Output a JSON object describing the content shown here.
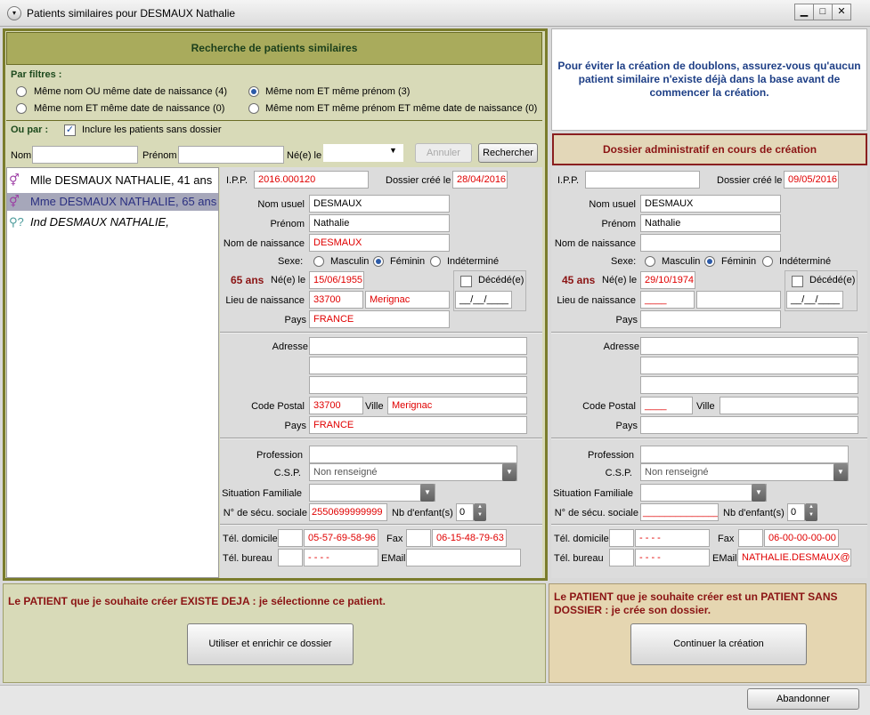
{
  "window": {
    "title": "Patients similaires pour DESMAUX Nathalie",
    "menu_icon": "▾",
    "minimize": "▁",
    "maximize": "□",
    "close": "✕"
  },
  "search": {
    "header": "Recherche de patients similaires",
    "filters_label": "Par filtres :",
    "filters": [
      {
        "label": "Même nom OU même date de naissance (4)",
        "selected": false
      },
      {
        "label": "Même nom ET même prénom (3)",
        "selected": true
      },
      {
        "label": "Même nom ET même date de naissance (0)",
        "selected": false
      },
      {
        "label": "Même nom ET même prénom ET même date de naissance (0)",
        "selected": false
      }
    ],
    "ou_par_label": "Ou par :",
    "include_no_file_label": "Inclure les patients sans dossier",
    "include_no_file_checked": "✓",
    "nom_label": "Nom",
    "prenom_label": "Prénom",
    "ne_le_label": "Né(e) le",
    "annuler_button": "Annuler",
    "rechercher_button": "Rechercher"
  },
  "results": [
    {
      "label": "Mlle DESMAUX NATHALIE, 41 ans",
      "icon": "female-icon",
      "selected": false
    },
    {
      "label": "Mme DESMAUX NATHALIE, 65 ans",
      "icon": "female-icon",
      "selected": true
    },
    {
      "label": "Ind DESMAUX NATHALIE,",
      "icon": "unknown-gender-icon",
      "selected": false
    }
  ],
  "labels": {
    "ipp": "I.P.P.",
    "dossier_cree": "Dossier créé le",
    "nom_usuel": "Nom usuel",
    "prenom": "Prénom",
    "nom_naissance": "Nom de naissance",
    "sexe": "Sexe:",
    "masculin": "Masculin",
    "feminin": "Féminin",
    "indetermine": "Indéterminé",
    "ne_le": "Né(e) le",
    "decede": "Décédé(e)",
    "lieu_naissance": "Lieu de naissance",
    "pays": "Pays",
    "adresse": "Adresse",
    "code_postal": "Code Postal",
    "ville": "Ville",
    "profession": "Profession",
    "csp": "C.S.P.",
    "situation_familiale": "Situation Familiale",
    "secu": "N° de sécu. sociale",
    "nb_enfants": "Nb d'enfant(s)",
    "tel_domicile": "Tél. domicile",
    "fax": "Fax",
    "tel_bureau": "Tél. bureau",
    "email": "EMail"
  },
  "existing": {
    "ipp": "2016.000120",
    "dossier_cree": "28/04/2016",
    "nom_usuel": "DESMAUX",
    "prenom": "Nathalie",
    "nom_naissance": "DESMAUX",
    "age": "65 ans",
    "naissance": "15/06/1955",
    "deces": "__/__/____",
    "lieu_cp": "33700",
    "lieu_ville": "Merignac",
    "pays": "FRANCE",
    "adresse1": "",
    "adresse2": "",
    "adresse3": "",
    "code_postal": "33700",
    "ville": "Merignac",
    "pays_adresse": "FRANCE",
    "profession": "",
    "csp": "Non renseigné",
    "situation": "",
    "secu": "2550699999999",
    "nb_enfants": "0",
    "tel_domicile": "05-57-69-58-96",
    "fax": "06-15-48-79-63",
    "tel_bureau": "- - - -",
    "email": "",
    "sexe": "Féminin",
    "message": "Le PATIENT que je souhaite créer EXISTE DEJA : je sélectionne ce patient.",
    "button": "Utiliser et enrichir ce dossier"
  },
  "new": {
    "info": "Pour éviter la création de doublons, assurez-vous qu'aucun patient similaire n'existe déjà dans la base avant de commencer la création.",
    "header": "Dossier administratif en cours de création",
    "ipp": "",
    "dossier_cree": "09/05/2016",
    "nom_usuel": "DESMAUX",
    "prenom": "Nathalie",
    "nom_naissance": "",
    "age": "45 ans",
    "naissance": "29/10/1974",
    "deces": "__/__/____",
    "lieu_cp": "____",
    "lieu_ville": "",
    "pays": "",
    "code_postal": "____",
    "ville": "",
    "pays_adresse": "",
    "profession": "",
    "csp": "Non renseigné",
    "situation": "",
    "secu": "_______________",
    "nb_enfants": "0",
    "tel_domicile": "- - - -",
    "fax": "06-00-00-00-00",
    "tel_bureau": "- - - -",
    "email": "NATHALIE.DESMAUX@Y",
    "sexe": "Féminin",
    "message": "Le PATIENT que je souhaite créer est un PATIENT SANS DOSSIER : je crée son dossier.",
    "button": "Continuer la création"
  },
  "footer": {
    "abandon_button": "Abandonner"
  },
  "colors": {
    "green_panel": "#d8dab8",
    "green_header": "#a9ab5c",
    "panel_border": "#7a7c2c",
    "alert_text": "#8b1414",
    "info_text": "#1e3f86",
    "value_red": "#e00000"
  }
}
